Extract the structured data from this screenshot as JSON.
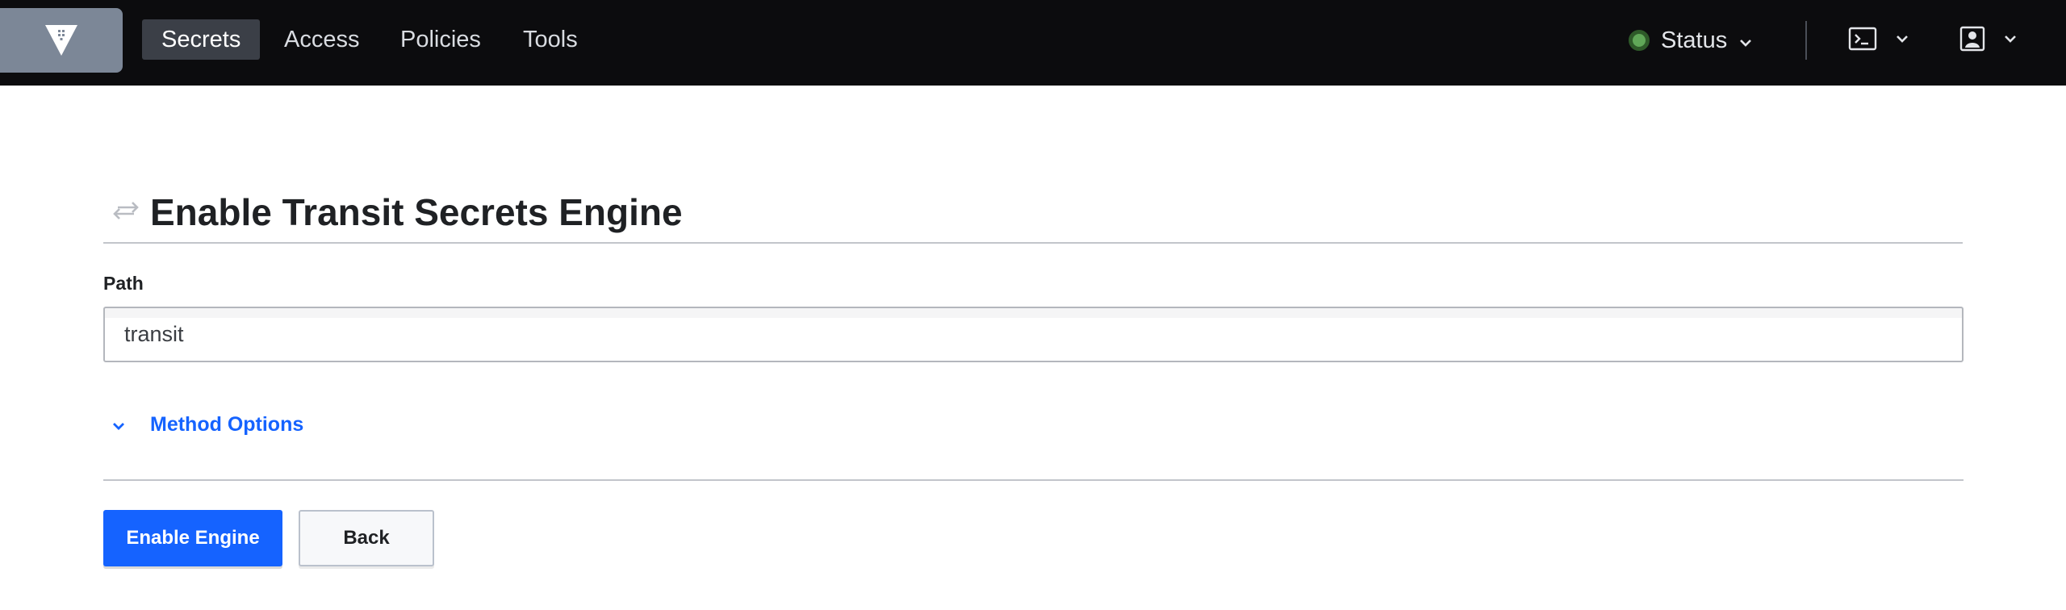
{
  "nav": {
    "logo_icon": "vault-logo-icon",
    "items": [
      {
        "label": "Secrets",
        "active": true
      },
      {
        "label": "Access",
        "active": false
      },
      {
        "label": "Policies",
        "active": false
      },
      {
        "label": "Tools",
        "active": false
      }
    ],
    "status_label": "Status",
    "status_color": "#60a758",
    "console_icon": "terminal-icon",
    "user_icon": "user-icon"
  },
  "page": {
    "title_icon": "transit-arrows-icon",
    "title": "Enable Transit Secrets Engine",
    "path_label": "Path",
    "path_value": "transit",
    "method_options_label": "Method Options",
    "enable_button": "Enable Engine",
    "back_button": "Back"
  },
  "colors": {
    "accent": "#1563ff",
    "nav_bg": "#0c0c0e"
  }
}
